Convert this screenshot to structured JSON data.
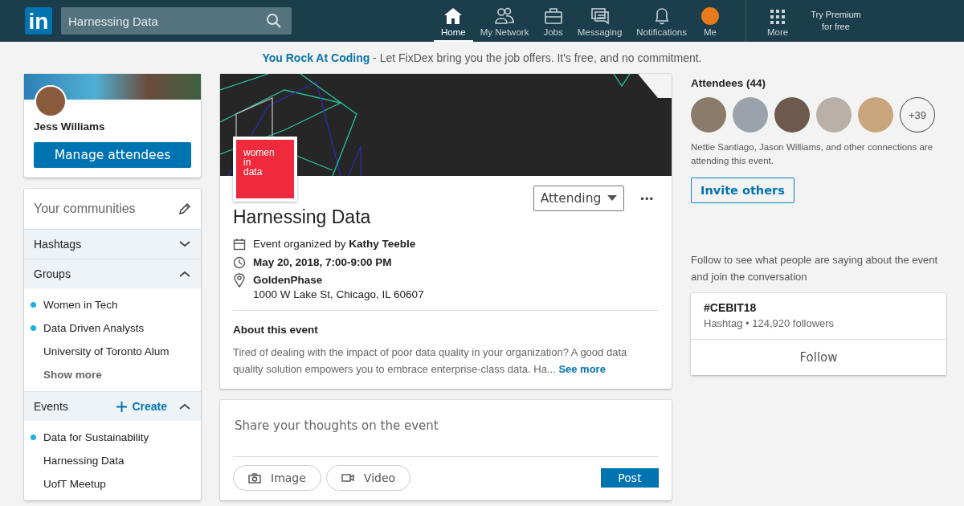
{
  "nav": {
    "logo": "in",
    "search": {
      "value": "Harnessing Data"
    },
    "items": [
      {
        "label": "Home",
        "kind": "home",
        "selected": true
      },
      {
        "label": "My Network",
        "kind": "network",
        "selected": false
      },
      {
        "label": "Jobs",
        "kind": "jobs",
        "selected": false
      },
      {
        "label": "Messaging",
        "kind": "messaging",
        "selected": false
      },
      {
        "label": "Notifications",
        "kind": "notifications",
        "selected": false
      },
      {
        "label": "Me",
        "kind": "me",
        "selected": false
      }
    ],
    "more": "More",
    "premium": [
      "Try Premium",
      "for free"
    ]
  },
  "promo": {
    "link": "You Rock At Coding",
    "text": " - Let FixDex bring you the job offers. It's free, and no commitment."
  },
  "profile": {
    "name": "Jess Williams",
    "button": "Manage attendees"
  },
  "communities": {
    "title": "Your communities",
    "sections": [
      {
        "title": "Hashtags",
        "expanded": false
      },
      {
        "title": "Groups",
        "expanded": true,
        "items": [
          {
            "label": "Women in Tech",
            "unread": true
          },
          {
            "label": "Data Driven Analysts",
            "unread": true
          },
          {
            "label": "University of Toronto Alum",
            "unread": false
          }
        ],
        "more": "Show more"
      },
      {
        "title": "Events",
        "expanded": true,
        "create": "Create",
        "items": [
          {
            "label": "Data for Sustainability",
            "unread": true
          },
          {
            "label": "Harnessing Data",
            "unread": false
          },
          {
            "label": "UofT Meetup",
            "unread": false
          }
        ]
      }
    ]
  },
  "event": {
    "logo": [
      "women",
      "in",
      "data"
    ],
    "attending": "Attending",
    "more": "•••",
    "title": "Harnessing Data",
    "organizer": "Event organized by **Kathy Teeble**",
    "date": "May 20, 2018, 7:00-9:00 PM",
    "venue": "GoldenPhase",
    "address": "1000 W Lake St, Chicago, IL 60607",
    "about_title": "About this event",
    "about": "Tired of dealing with the impact of poor data quality in your organization? A good data quality solution empowers you to embrace enterprise-class data. Ha...",
    "see_more": "See more"
  },
  "composer": {
    "placeholder": "Share your thoughts on the event",
    "image": "Image",
    "video": "Video",
    "post": "Post"
  },
  "attendees": {
    "title": "Attendees (44)",
    "extra": "+39",
    "text": "Nettie Santiago, Jason Williams, and other connections are attending this event.",
    "invite": "Invite others"
  },
  "hashtag": {
    "intro": "Follow to see what people are saying about the event and join the conversation",
    "tag": "#CEBIT18",
    "meta": "Hashtag • 124,920 followers",
    "follow": "Follow"
  }
}
